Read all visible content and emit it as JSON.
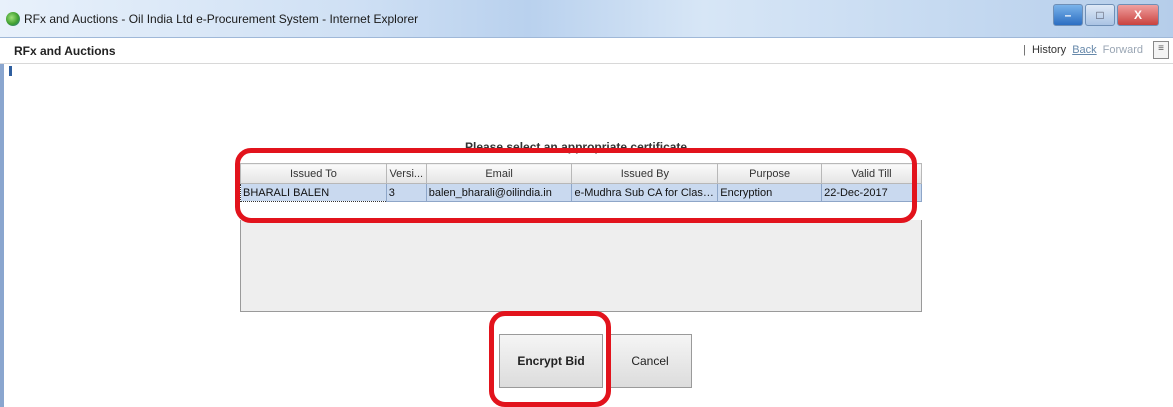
{
  "window": {
    "title": "RFx and Auctions - Oil India Ltd e-Procurement System - Internet Explorer",
    "controls": {
      "minimize": "–",
      "maximize": "□",
      "close": "X"
    }
  },
  "toolbar": {
    "app_label": "RFx and Auctions",
    "separator": "|",
    "history": "History",
    "back": "Back",
    "forward": "Forward"
  },
  "dialog": {
    "prompt": "Please select an appropriate certificate",
    "columns": [
      "Issued To",
      "Versi...",
      "Email",
      "Issued By",
      "Purpose",
      "Valid Till"
    ],
    "rows": [
      {
        "issued_to": "BHARALI BALEN",
        "version": "3",
        "email": "balen_bharali@oilindia.in",
        "issued_by": "e-Mudhra Sub CA for Class 3...",
        "purpose": "Encryption",
        "valid_till": "22-Dec-2017"
      }
    ],
    "encrypt_label": "Encrypt Bid",
    "cancel_label": "Cancel"
  },
  "colors": {
    "highlight": "#e2131c",
    "selected_row": "#c9d9ef",
    "titlebar": "#cfe0f4"
  }
}
